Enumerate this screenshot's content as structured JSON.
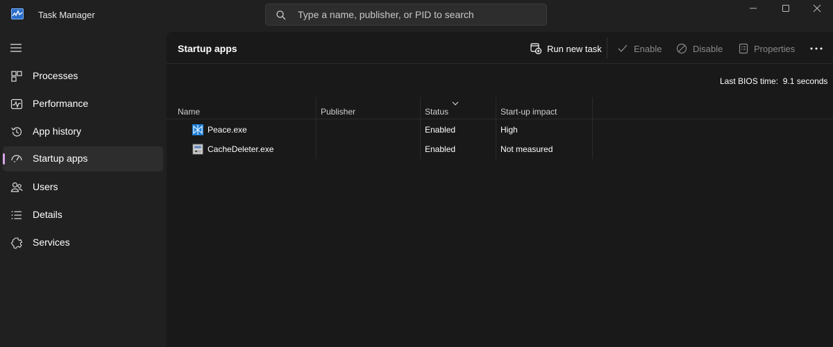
{
  "window": {
    "title": "Task Manager",
    "app_icon": "task-manager-icon",
    "controls": [
      "minimize-icon",
      "maximize-icon",
      "close-icon"
    ]
  },
  "search": {
    "placeholder": "Type a name, publisher, or PID to search",
    "icon": "search-icon"
  },
  "sidebar": {
    "menu_icon": "hamburger-menu-icon",
    "items": [
      {
        "label": "Processes",
        "icon": "processes-icon"
      },
      {
        "label": "Performance",
        "icon": "performance-icon"
      },
      {
        "label": "App history",
        "icon": "app-history-icon"
      },
      {
        "label": "Startup apps",
        "icon": "startup-apps-icon",
        "selected": true
      },
      {
        "label": "Users",
        "icon": "users-icon"
      },
      {
        "label": "Details",
        "icon": "details-icon"
      },
      {
        "label": "Services",
        "icon": "services-icon"
      }
    ],
    "accent_color": "#d7a8e8"
  },
  "toolbar": {
    "title": "Startup apps",
    "run_new_task": "Run new task",
    "enable": "Enable",
    "disable": "Disable",
    "properties": "Properties",
    "more_icon": "more-options-icon"
  },
  "bios": {
    "label": "Last BIOS time:",
    "value": "9.1 seconds"
  },
  "table": {
    "columns": [
      "Name",
      "Publisher",
      "Status",
      "Start-up impact"
    ],
    "sorted_column": "Status",
    "rows": [
      {
        "name": "Peace.exe",
        "publisher": "",
        "status": "Enabled",
        "impact": "High",
        "icon": "peace-app-icon"
      },
      {
        "name": "CacheDeleter.exe",
        "publisher": "",
        "status": "Enabled",
        "impact": "Not measured",
        "icon": "cachedeleter-app-icon"
      }
    ]
  },
  "colors": {
    "background": "#202020",
    "content_background": "#191919",
    "selected_nav": "#2d2d2d",
    "disabled_text": "#8a8a8a"
  }
}
